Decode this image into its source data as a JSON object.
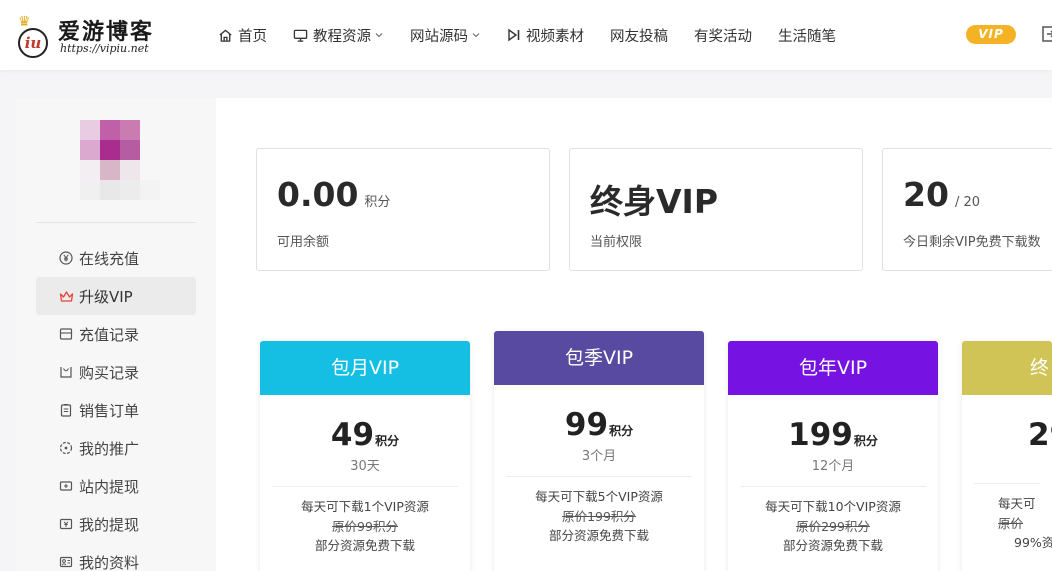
{
  "header": {
    "logo": {
      "name": "爱游博客",
      "url": "https://vipiu.net",
      "badge_letter": "iu"
    },
    "nav": [
      {
        "label": "首页",
        "icon": "home-icon",
        "has_dropdown": false
      },
      {
        "label": "教程资源",
        "icon": "monitor-icon",
        "has_dropdown": true
      },
      {
        "label": "网站源码",
        "icon": "",
        "has_dropdown": true
      },
      {
        "label": "视频素材",
        "icon": "play-next-icon",
        "has_dropdown": false
      },
      {
        "label": "网友投稿",
        "icon": "",
        "has_dropdown": false
      },
      {
        "label": "有奖活动",
        "icon": "",
        "has_dropdown": false
      },
      {
        "label": "生活随笔",
        "icon": "",
        "has_dropdown": false
      }
    ],
    "vip_badge": "VIP"
  },
  "sidebar": {
    "menu": [
      {
        "label": "在线充值",
        "icon": "yen-icon",
        "active": false
      },
      {
        "label": "升级VIP",
        "icon": "crown-icon",
        "active": true
      },
      {
        "label": "充值记录",
        "icon": "wallet-icon",
        "active": false
      },
      {
        "label": "购买记录",
        "icon": "bag-icon",
        "active": false
      },
      {
        "label": "销售订单",
        "icon": "clipboard-icon",
        "active": false
      },
      {
        "label": "我的推广",
        "icon": "share-icon",
        "active": false
      },
      {
        "label": "站内提现",
        "icon": "withdraw-icon",
        "active": false
      },
      {
        "label": "我的提现",
        "icon": "cash-icon",
        "active": false
      },
      {
        "label": "我的资料",
        "icon": "id-card-icon",
        "active": false
      }
    ]
  },
  "stats": [
    {
      "value": "0.00",
      "unit": "积分",
      "label": "可用余额"
    },
    {
      "value": "终身VIP",
      "unit": "",
      "label": "当前权限"
    },
    {
      "value": "20",
      "unit": "/ 20",
      "label": "今日剩余VIP免费下载数"
    }
  ],
  "plans": [
    {
      "title": "包月VIP",
      "price": "49",
      "unit": "积分",
      "period": "30天",
      "features": [
        "每天可下载1个VIP资源",
        "原价99积分",
        "部分资源免费下载"
      ]
    },
    {
      "title": "包季VIP",
      "price": "99",
      "unit": "积分",
      "period": "3个月",
      "features": [
        "每天可下载5个VIP资源",
        "原价199积分",
        "部分资源免费下载"
      ]
    },
    {
      "title": "包年VIP",
      "price": "199",
      "unit": "积分",
      "period": "12个月",
      "features": [
        "每天可下载10个VIP资源",
        "原价299积分",
        "部分资源免费下载"
      ]
    },
    {
      "title": "终",
      "price": "29",
      "unit": "",
      "period": "",
      "features": [
        "每天可",
        "原价",
        "99%资"
      ]
    }
  ],
  "colors": {
    "accent_vip_badge": "#f4b324",
    "plan_monthly": "#15bfe4",
    "plan_quarterly": "#574aa0",
    "plan_yearly": "#7612e2",
    "plan_lifetime": "#d1c457",
    "crown_icon": "#e8443a"
  }
}
